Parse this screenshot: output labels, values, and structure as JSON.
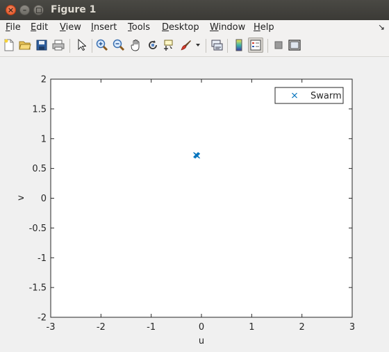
{
  "window": {
    "title": "Figure 1"
  },
  "menu": {
    "items": [
      {
        "label": "File",
        "mnemonic_index": 0
      },
      {
        "label": "Edit",
        "mnemonic_index": 0
      },
      {
        "label": "View",
        "mnemonic_index": 0
      },
      {
        "label": "Insert",
        "mnemonic_index": 0
      },
      {
        "label": "Tools",
        "mnemonic_index": 0
      },
      {
        "label": "Desktop",
        "mnemonic_index": 0
      },
      {
        "label": "Window",
        "mnemonic_index": 0
      },
      {
        "label": "Help",
        "mnemonic_index": 0
      }
    ],
    "dock_icon": "dock-arrow-icon"
  },
  "toolbar": {
    "buttons": [
      "new-figure-icon",
      "open-file-icon",
      "save-icon",
      "print-icon",
      "select-arrow-icon",
      "zoom-in-icon",
      "zoom-out-icon",
      "pan-hand-icon",
      "rotate-3d-icon",
      "data-cursor-icon",
      "brush-icon",
      "brush-dropdown-icon",
      "link-plot-icon",
      "colorbar-icon",
      "legend-icon",
      "hide-plot-tools-icon",
      "show-plot-tools-icon"
    ],
    "pressed": [
      "legend-icon"
    ]
  },
  "chart_data": {
    "type": "scatter",
    "title": "",
    "xlabel": "u",
    "ylabel": "v",
    "xlim": [
      -3,
      3
    ],
    "ylim": [
      -2,
      2
    ],
    "xticks": [
      -3,
      -2,
      -1,
      0,
      1,
      2,
      3
    ],
    "xtick_labels": [
      "-3",
      "-2",
      "-1",
      "0",
      "1",
      "2",
      "3"
    ],
    "yticks": [
      -2,
      -1.5,
      -1,
      -0.5,
      0,
      0.5,
      1,
      1.5,
      2
    ],
    "ytick_labels": [
      "-2",
      "-1.5",
      "-1",
      "-0.5",
      "0",
      "0.5",
      "1",
      "1.5",
      "2"
    ],
    "grid": false,
    "legend_position": "top-right",
    "series": [
      {
        "name": "Swarm",
        "marker": "x",
        "color": "#0072bd",
        "points": [
          {
            "x": -0.1,
            "y": 0.72
          },
          {
            "x": -0.08,
            "y": 0.71
          },
          {
            "x": -0.11,
            "y": 0.73
          },
          {
            "x": -0.09,
            "y": 0.72
          }
        ]
      }
    ]
  }
}
